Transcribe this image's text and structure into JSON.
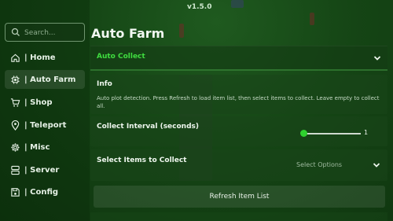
{
  "version": "v1.5.0",
  "search": {
    "placeholder": "Search..."
  },
  "sidebar": {
    "items": [
      {
        "label": "| Home",
        "icon": "home-icon"
      },
      {
        "label": "| Auto Farm",
        "icon": "chip-icon"
      },
      {
        "label": "| Shop",
        "icon": "cart-icon"
      },
      {
        "label": "| Teleport",
        "icon": "map-pin-icon"
      },
      {
        "label": "| Misc",
        "icon": "gear-icon"
      },
      {
        "label": "| Server",
        "icon": "server-icon"
      },
      {
        "label": "| Config",
        "icon": "save-icon"
      }
    ]
  },
  "main": {
    "title": "Auto Farm",
    "section": {
      "label": "Auto Collect"
    },
    "info": {
      "title": "Info",
      "description": "Auto plot detection. Press Refresh to load item list, then select items to collect. Leave empty to collect all."
    },
    "interval": {
      "label": "Collect Interval (seconds)",
      "value": "1",
      "fraction": 0.0
    },
    "select": {
      "label": "Select Items to Collect",
      "placeholder": "Select Options"
    },
    "refresh": {
      "label": "Refresh Item List"
    }
  },
  "colors": {
    "accent": "#3fdc3f",
    "panel": "#1a4a1a"
  }
}
